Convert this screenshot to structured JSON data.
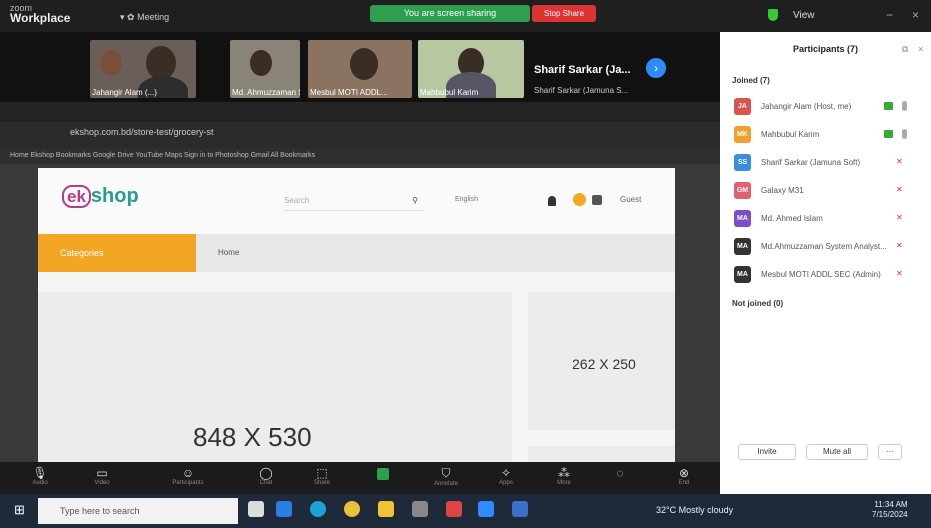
{
  "app": {
    "brand_top": "zoom",
    "brand_name": "Workplace",
    "meeting_label": "Meeting",
    "view_label": "View",
    "sharing_banner": "You are screen sharing",
    "stop_share": "Stop Share"
  },
  "participants_strip": {
    "tiles": [
      {
        "name": "Jahangir Alam (...)"
      },
      {
        "name": "Md. Ahmuzzaman Syst..."
      },
      {
        "name": "Mesbul MOTI ADDL..."
      },
      {
        "name": "Mahbubul Karim"
      }
    ],
    "spotlight_name": "Sharif Sarkar (Ja...",
    "spotlight_sub": "Sharif Sarkar (Jamuna S..."
  },
  "browser": {
    "address": "ekshop.com.bd/store-test/grocery-st",
    "bookmarks": "Home  Ekshop  Bookmarks  Google  Drive  YouTube  Maps  Sign in to Photoshop  Gmail  All Bookmarks"
  },
  "site": {
    "logo_ek": "ek",
    "logo_shop": "shop",
    "search_placeholder": "Search",
    "language": "English",
    "account": "Guest",
    "categories": "Categories",
    "home": "Home",
    "banner_main": "848 X 530",
    "banner_side": "262 X 250"
  },
  "panel": {
    "title": "Participants (7)",
    "joined_label": "Joined (7)",
    "not_joined_label": "Not joined (0)",
    "invite": "Invite",
    "mute_all": "Mute all",
    "participants": [
      {
        "initials": "JA",
        "color": "#d9534f",
        "name": "Jahangir Alam (Host, me)"
      },
      {
        "initials": "MK",
        "color": "#f0a030",
        "name": "Mahbubul Karim"
      },
      {
        "initials": "SS",
        "color": "#3b8de0",
        "name": "Sharif Sarkar (Jamuna Soft)"
      },
      {
        "initials": "GM",
        "color": "#e06070",
        "name": "Galaxy M31"
      },
      {
        "initials": "MA",
        "color": "#7b4fc8",
        "name": "Md. Ahmed Islam"
      },
      {
        "initials": "MA",
        "color": "#333333",
        "name": "Md.Ahmuzzaman System Analyst..."
      },
      {
        "initials": "MA",
        "color": "#333333",
        "name": "Mesbul MOTI ADDL SEC (Admin)"
      }
    ]
  },
  "toolbar": {
    "items": [
      "Audio",
      "Video",
      "Participants",
      "Chat",
      "Share",
      "New Share",
      "Annotate",
      "Apps",
      "More",
      "End"
    ]
  },
  "taskbar": {
    "search_placeholder": "Type here to search",
    "weather": "32°C  Mostly cloudy",
    "time": "11:34 AM",
    "date": "7/15/2024"
  }
}
